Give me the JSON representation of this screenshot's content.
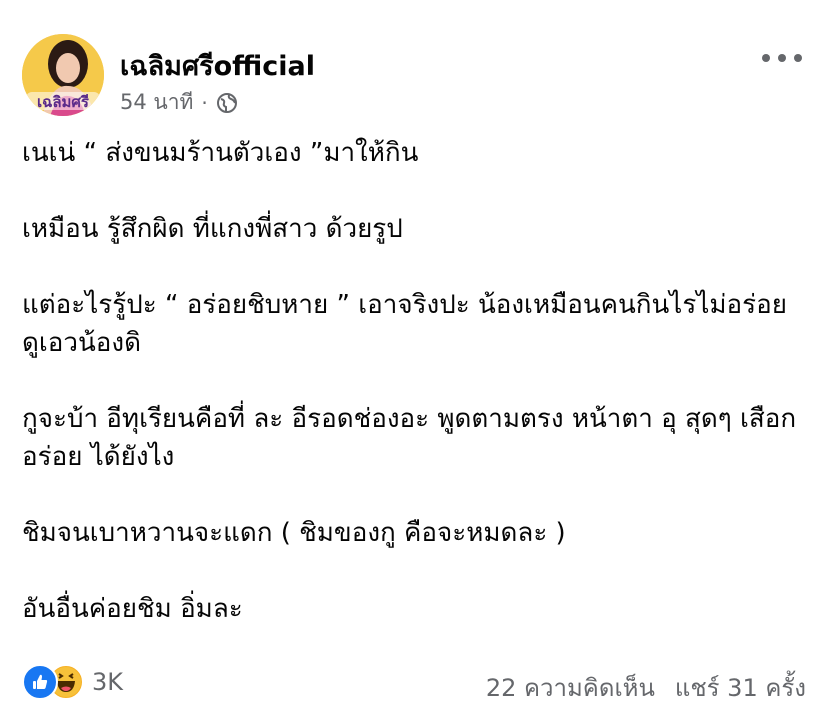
{
  "post": {
    "author": "เฉลิมศรีofficial",
    "time": "54 นาที",
    "separator": "·",
    "privacy_icon": "globe-icon",
    "menu_icon": "more-horizontal-icon",
    "avatar_text": "เฉลิมศรี",
    "body": [
      "เนเน่ “ ส่งขนมร้านตัวเอง ”มาให้กิน",
      "เหมือน รู้สึกผิด ที่แกงพี่สาว ด้วยรูป",
      "แต่อะไรรู้ปะ “ อร่อยชิบหาย ” เอาจริงปะ น้องเหมือนคนกินไรไม่อร่อย ดูเอวน้องดิ",
      "กูจะบ้า อีทุเรียนคือที่ ละ อีรอดช่องอะ พูดตามตรง หน้าตา อุ สุดๆ เสือกอร่อย ได้ยังไง",
      "ชิมจนเบาหวานจะแดก ( ชิมของกู คือจะหมดละ )",
      "อันอื่นค่อยชิม อิ่มละ"
    ]
  },
  "footer": {
    "reaction_icons": [
      "like-icon",
      "haha-icon"
    ],
    "reaction_count": "3K",
    "comments": "22 ความคิดเห็น",
    "shares": "แชร์ 31 ครั้ง"
  },
  "colors": {
    "text": "#050505",
    "secondary": "#65676b",
    "like": "#1877f2",
    "haha": "#f7b125"
  }
}
